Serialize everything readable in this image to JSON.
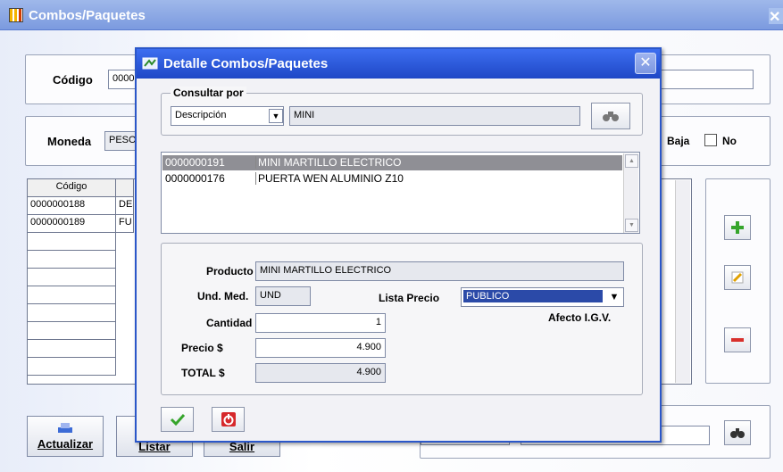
{
  "main": {
    "title": "Combos/Paquetes",
    "codigo_label": "Código",
    "codigo_value": "0000",
    "moneda_label": "Moneda",
    "moneda_value": "PESO",
    "baja_label": "Baja",
    "no_label": "No",
    "table": {
      "header": "Código",
      "rows": [
        {
          "code": "0000000188",
          "desc": "DES"
        },
        {
          "code": "0000000189",
          "desc": "FU"
        }
      ]
    },
    "buttons": {
      "actualizar": "Actualizar",
      "listar": "Listar",
      "salir": "Salir"
    }
  },
  "dialog": {
    "title": "Detalle Combos/Paquetes",
    "consultar_por_label": "Consultar por",
    "consultar_por_selected": "Descripción",
    "search_value": "MINI",
    "results": [
      {
        "code": "0000000191",
        "name": "MINI MARTILLO ELECTRICO"
      },
      {
        "code": "0000000176",
        "name": "PUERTA WEN ALUMINIO Z10"
      }
    ],
    "producto_label": "Producto",
    "producto_value": "MINI MARTILLO ELECTRICO",
    "und_label": "Und. Med.",
    "und_value": "UND",
    "lista_label": "Lista Precio",
    "lista_value": "PUBLICO",
    "cantidad_label": "Cantidad",
    "cantidad_value": "1",
    "afecto_label": "Afecto I.G.V.",
    "precio_label": "Precio $",
    "precio_value": "4.900",
    "total_label": "TOTAL $",
    "total_value": "4.900"
  },
  "colors": {
    "dialog_title": "#1e47c6",
    "main_title": "#7b9adf",
    "selected_row": "#8f8f95",
    "selected_field": "#2b4aa8"
  },
  "icons": [
    "app-icon",
    "binoculars-icon",
    "check-icon",
    "power-icon",
    "plus-icon",
    "edit-icon",
    "minus-icon",
    "refresh-icon"
  ]
}
